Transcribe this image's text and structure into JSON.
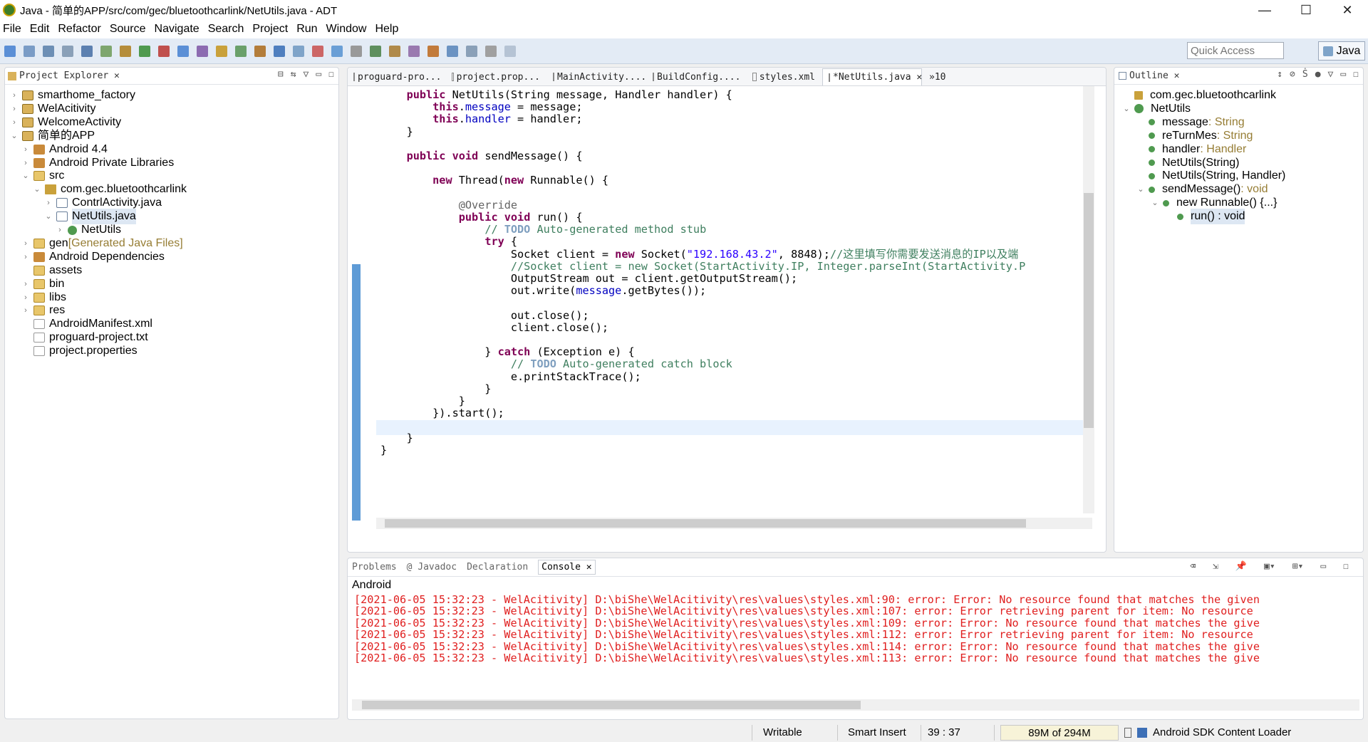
{
  "window": {
    "title": "Java - 简单的APP/src/com/gec/bluetoothcarlink/NetUtils.java - ADT",
    "min": "—",
    "max": "☐",
    "close": "✕"
  },
  "menu": [
    "File",
    "Edit",
    "Refactor",
    "Source",
    "Navigate",
    "Search",
    "Project",
    "Run",
    "Window",
    "Help"
  ],
  "toolbar": {
    "quick_access_placeholder": "Quick Access",
    "perspective": "Java"
  },
  "project_explorer": {
    "tab": "Project Explorer ✕",
    "items": [
      {
        "label": "smarthome_factory",
        "depth": 0,
        "arrow": "›",
        "icon": "project-icon"
      },
      {
        "label": "WelAcitivity",
        "depth": 0,
        "arrow": "›",
        "icon": "project-icon"
      },
      {
        "label": "WelcomeActivity",
        "depth": 0,
        "arrow": "›",
        "icon": "project-icon"
      },
      {
        "label": "简单的APP",
        "depth": 0,
        "arrow": "⌄",
        "icon": "project-icon"
      },
      {
        "label": "Android 4.4",
        "depth": 1,
        "arrow": "›",
        "icon": "library-icon"
      },
      {
        "label": "Android Private Libraries",
        "depth": 1,
        "arrow": "›",
        "icon": "library-icon"
      },
      {
        "label": "src",
        "depth": 1,
        "arrow": "⌄",
        "icon": "folder-icon"
      },
      {
        "label": "com.gec.bluetoothcarlink",
        "depth": 2,
        "arrow": "⌄",
        "icon": "package-icon"
      },
      {
        "label": "ContrlActivity.java",
        "depth": 3,
        "arrow": "›",
        "icon": "java-file-icon"
      },
      {
        "label": "NetUtils.java",
        "depth": 3,
        "arrow": "⌄",
        "icon": "java-file-icon",
        "selected": true
      },
      {
        "label": "NetUtils",
        "depth": 4,
        "arrow": "›",
        "icon": "class-icon"
      },
      {
        "label": "gen",
        "suffix": " [Generated Java Files]",
        "depth": 1,
        "arrow": "›",
        "icon": "folder-icon"
      },
      {
        "label": "Android Dependencies",
        "depth": 1,
        "arrow": "›",
        "icon": "library-icon"
      },
      {
        "label": "assets",
        "depth": 1,
        "arrow": "",
        "icon": "folder-icon"
      },
      {
        "label": "bin",
        "depth": 1,
        "arrow": "›",
        "icon": "folder-icon"
      },
      {
        "label": "libs",
        "depth": 1,
        "arrow": "›",
        "icon": "folder-icon"
      },
      {
        "label": "res",
        "depth": 1,
        "arrow": "›",
        "icon": "folder-icon"
      },
      {
        "label": "AndroidManifest.xml",
        "depth": 1,
        "arrow": "",
        "icon": "xml-file-icon"
      },
      {
        "label": "proguard-project.txt",
        "depth": 1,
        "arrow": "",
        "icon": "text-file-icon"
      },
      {
        "label": "project.properties",
        "depth": 1,
        "arrow": "",
        "icon": "text-file-icon"
      }
    ]
  },
  "editor": {
    "tabs": [
      {
        "label": "proguard-pro...",
        "active": false
      },
      {
        "label": "project.prop...",
        "active": false
      },
      {
        "label": "MainActivity....",
        "active": false
      },
      {
        "label": "BuildConfig....",
        "active": false
      },
      {
        "label": "styles.xml",
        "active": false
      },
      {
        "label": "*NetUtils.java ✕",
        "active": true
      },
      {
        "label": "»10",
        "active": false
      }
    ],
    "lines": [
      [
        [
          "    ",
          ""
        ],
        [
          "public",
          "kw"
        ],
        [
          " NetUtils(String message, Handler handler) {",
          ""
        ]
      ],
      [
        [
          "        ",
          ""
        ],
        [
          "this",
          "kw"
        ],
        [
          ".",
          ""
        ],
        [
          "message",
          "fld"
        ],
        [
          " = message;",
          ""
        ]
      ],
      [
        [
          "        ",
          ""
        ],
        [
          "this",
          "kw"
        ],
        [
          ".",
          ""
        ],
        [
          "handler",
          "fld"
        ],
        [
          " = handler;",
          ""
        ]
      ],
      [
        [
          "    }",
          ""
        ]
      ],
      [
        [
          "",
          ""
        ]
      ],
      [
        [
          "    ",
          ""
        ],
        [
          "public",
          "kw"
        ],
        [
          " ",
          ""
        ],
        [
          "void",
          "kw"
        ],
        [
          " sendMessage() {",
          ""
        ]
      ],
      [
        [
          "",
          ""
        ]
      ],
      [
        [
          "        ",
          ""
        ],
        [
          "new",
          "kw"
        ],
        [
          " Thread(",
          ""
        ],
        [
          "new",
          "kw"
        ],
        [
          " Runnable() {",
          ""
        ]
      ],
      [
        [
          "",
          ""
        ]
      ],
      [
        [
          "            ",
          ""
        ],
        [
          "@Override",
          "ann"
        ]
      ],
      [
        [
          "            ",
          ""
        ],
        [
          "public",
          "kw"
        ],
        [
          " ",
          ""
        ],
        [
          "void",
          "kw"
        ],
        [
          " run() {",
          ""
        ]
      ],
      [
        [
          "                ",
          ""
        ],
        [
          "// ",
          "cm"
        ],
        [
          "TODO",
          "todo"
        ],
        [
          " Auto-generated method stub",
          "cm"
        ]
      ],
      [
        [
          "                ",
          ""
        ],
        [
          "try",
          "kw"
        ],
        [
          " {",
          ""
        ]
      ],
      [
        [
          "                    Socket client = ",
          ""
        ],
        [
          "new",
          "kw"
        ],
        [
          " Socket(",
          ""
        ],
        [
          "\"192.168.43.2\"",
          "str"
        ],
        [
          ", 8848);",
          ""
        ],
        [
          "//这里填写你需要发送消息的IP以及端",
          "cm"
        ]
      ],
      [
        [
          "                    ",
          ""
        ],
        [
          "//Socket client = new Socket(StartActivity.IP, Integer.parseInt(StartActivity.P",
          "cm"
        ]
      ],
      [
        [
          "                    OutputStream out = client.getOutputStream();",
          ""
        ]
      ],
      [
        [
          "                    out.write(",
          ""
        ],
        [
          "message",
          "fld"
        ],
        [
          ".getBytes());",
          ""
        ]
      ],
      [
        [
          "",
          ""
        ]
      ],
      [
        [
          "                    out.close();",
          ""
        ]
      ],
      [
        [
          "                    client.close();",
          ""
        ]
      ],
      [
        [
          "",
          ""
        ]
      ],
      [
        [
          "                } ",
          ""
        ],
        [
          "catch",
          "kw"
        ],
        [
          " (Exception e) {",
          ""
        ]
      ],
      [
        [
          "                    ",
          ""
        ],
        [
          "// ",
          "cm"
        ],
        [
          "TODO",
          "todo"
        ],
        [
          " Auto-generated catch block",
          "cm"
        ]
      ],
      [
        [
          "                    e.printStackTrace();",
          ""
        ]
      ],
      [
        [
          "                }",
          ""
        ]
      ],
      [
        [
          "            }",
          ""
        ]
      ],
      [
        [
          "        }).start();",
          ""
        ]
      ],
      [
        [
          "",
          ""
        ]
      ],
      [
        [
          "    }",
          ""
        ]
      ],
      [
        [
          "}",
          ""
        ]
      ]
    ]
  },
  "outline": {
    "tab": "Outline ✕",
    "items": [
      {
        "label": "com.gec.bluetoothcarlink",
        "type": "",
        "depth": 0,
        "arrow": "",
        "icon": "package-icon"
      },
      {
        "label": "NetUtils",
        "type": "",
        "depth": 0,
        "arrow": "⌄",
        "icon": "class-icon"
      },
      {
        "label": "message",
        "type": " : String",
        "depth": 1,
        "arrow": "",
        "icon": "field-icon"
      },
      {
        "label": "reTurnMes",
        "type": " : String",
        "depth": 1,
        "arrow": "",
        "icon": "field-icon"
      },
      {
        "label": "handler",
        "type": " : Handler",
        "depth": 1,
        "arrow": "",
        "icon": "field-icon"
      },
      {
        "label": "NetUtils(String)",
        "type": "",
        "depth": 1,
        "arrow": "",
        "icon": "constructor-icon"
      },
      {
        "label": "NetUtils(String, Handler)",
        "type": "",
        "depth": 1,
        "arrow": "",
        "icon": "constructor-icon"
      },
      {
        "label": "sendMessage()",
        "type": " : void",
        "depth": 1,
        "arrow": "⌄",
        "icon": "method-icon"
      },
      {
        "label": "new Runnable() {...}",
        "type": "",
        "depth": 2,
        "arrow": "⌄",
        "icon": "anon-class-icon"
      },
      {
        "label": "run() : void",
        "type": "",
        "depth": 3,
        "arrow": "",
        "icon": "method-icon",
        "selected": true
      }
    ]
  },
  "console": {
    "tabs": [
      "Problems",
      "@ Javadoc",
      "Declaration",
      "Console ✕"
    ],
    "name": "Android",
    "lines": [
      "[2021-06-05 15:32:23 - WelAcitivity] D:\\biShe\\WelAcitivity\\res\\values\\styles.xml:90: error: Error: No resource found that matches the given",
      "[2021-06-05 15:32:23 - WelAcitivity] D:\\biShe\\WelAcitivity\\res\\values\\styles.xml:107: error: Error retrieving parent for item: No resource",
      "[2021-06-05 15:32:23 - WelAcitivity] D:\\biShe\\WelAcitivity\\res\\values\\styles.xml:109: error: Error: No resource found that matches the give",
      "[2021-06-05 15:32:23 - WelAcitivity] D:\\biShe\\WelAcitivity\\res\\values\\styles.xml:112: error: Error retrieving parent for item: No resource",
      "[2021-06-05 15:32:23 - WelAcitivity] D:\\biShe\\WelAcitivity\\res\\values\\styles.xml:114: error: Error: No resource found that matches the give",
      "[2021-06-05 15:32:23 - WelAcitivity] D:\\biShe\\WelAcitivity\\res\\values\\styles.xml:113: error: Error: No resource found that matches the give"
    ]
  },
  "status": {
    "writable": "Writable",
    "insert_mode": "Smart Insert",
    "position": "39 : 37",
    "memory": "89M of 294M",
    "loader": "Android SDK Content Loader"
  },
  "colors": {
    "keyword": "#7f0055",
    "field": "#0000c0",
    "string": "#2a00ff",
    "comment": "#3f7f5f",
    "error": "#e02020",
    "toolbar_bg": "#e3ebf5"
  }
}
